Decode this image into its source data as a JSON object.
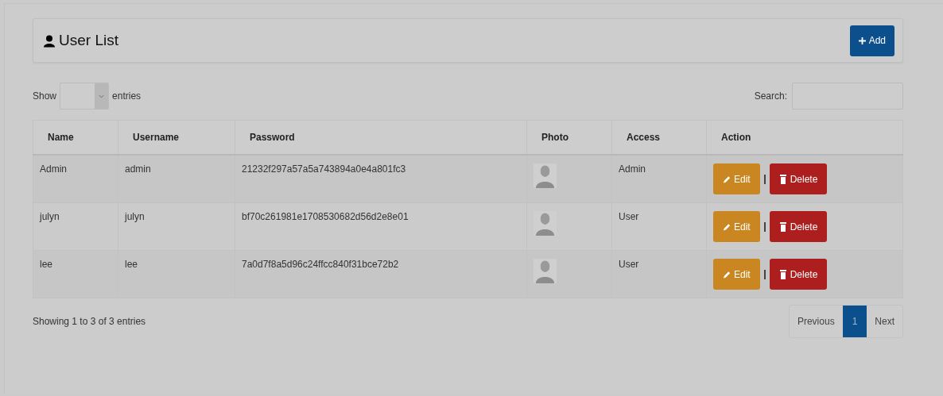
{
  "panel": {
    "title": "User List",
    "add_button": "Add"
  },
  "length_control": {
    "label_before": "Show",
    "label_after": "entries"
  },
  "search": {
    "label": "Search:"
  },
  "table": {
    "columns": [
      "Name",
      "Username",
      "Password",
      "Photo",
      "Access",
      "Action"
    ],
    "rows": [
      {
        "name": "Admin",
        "username": "admin",
        "password": "21232f297a57a5a743894a0e4a801fc3",
        "access": "Admin",
        "edit": "Edit",
        "delete": "Delete"
      },
      {
        "name": "julyn",
        "username": "julyn",
        "password": "bf70c261981e1708530682d56d2e8e01",
        "access": "User",
        "edit": "Edit",
        "delete": "Delete"
      },
      {
        "name": "lee",
        "username": "lee",
        "password": "7a0d7f8a5d96c24ffcc840f31bce72b2",
        "access": "User",
        "edit": "Edit",
        "delete": "Delete"
      }
    ]
  },
  "info": "Showing 1 to 3 of 3 entries",
  "pagination": [
    {
      "label": "Previous",
      "selected": false
    },
    {
      "label": "1",
      "selected": true
    },
    {
      "label": "Next",
      "selected": false
    }
  ]
}
